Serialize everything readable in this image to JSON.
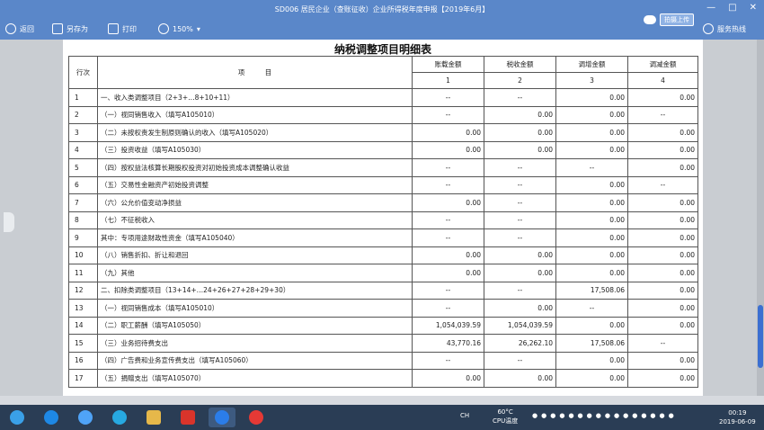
{
  "window": {
    "title": "SD006 居民企业（查账征收）企业所得税年度申报【2019年6月】",
    "minimize": "—",
    "maximize": "□",
    "close": "✕"
  },
  "toolbar": {
    "back": "返回",
    "save_as": "另存为",
    "print": "打印",
    "zoom": "150%",
    "upload": "拍摄上传",
    "hotline": "服务热线"
  },
  "doc": {
    "title": "纳税调整项目明细表",
    "headers": {
      "seq": "行次",
      "item": "项　　　目",
      "book": "账载金额",
      "tax": "税收金额",
      "inc": "调增金额",
      "dec": "调减金额",
      "n1": "1",
      "n2": "2",
      "n3": "3",
      "n4": "4"
    },
    "rows": [
      {
        "seq": "1",
        "item": "一、收入类调整项目（2+3+…8+10+11）",
        "c1": "--",
        "c2": "--",
        "c3": "0.00",
        "c4": "0.00"
      },
      {
        "seq": "2",
        "item": "（一）视同销售收入（填写A105010）",
        "c1": "--",
        "c2": "0.00",
        "c3": "0.00",
        "c4": "--"
      },
      {
        "seq": "3",
        "item": "（二）未按权责发生制原则确认的收入（填写A105020）",
        "c1": "0.00",
        "c2": "0.00",
        "c3": "0.00",
        "c4": "0.00"
      },
      {
        "seq": "4",
        "item": "（三）投资收益（填写A105030）",
        "c1": "0.00",
        "c2": "0.00",
        "c3": "0.00",
        "c4": "0.00"
      },
      {
        "seq": "5",
        "item": "（四）按权益法核算长期股权投资对初始投资成本调整确认收益",
        "c1": "--",
        "c2": "--",
        "c3": "--",
        "c4": "0.00"
      },
      {
        "seq": "6",
        "item": "（五）交易性金融资产初始投资调整",
        "c1": "--",
        "c2": "--",
        "c3": "0.00",
        "c4": "--"
      },
      {
        "seq": "7",
        "item": "（六）公允价值变动净损益",
        "c1": "0.00",
        "c2": "--",
        "c3": "0.00",
        "c4": "0.00"
      },
      {
        "seq": "8",
        "item": "（七）不征税收入",
        "c1": "--",
        "c2": "--",
        "c3": "0.00",
        "c4": "0.00"
      },
      {
        "seq": "9",
        "item": "其中：专项用途财政性资金（填写A105040）",
        "c1": "--",
        "c2": "--",
        "c3": "0.00",
        "c4": "0.00"
      },
      {
        "seq": "10",
        "item": "（八）销售折扣、折让和退回",
        "c1": "0.00",
        "c2": "0.00",
        "c3": "0.00",
        "c4": "0.00"
      },
      {
        "seq": "11",
        "item": "（九）其他",
        "c1": "0.00",
        "c2": "0.00",
        "c3": "0.00",
        "c4": "0.00"
      },
      {
        "seq": "12",
        "item": "二、扣除类调整项目（13+14+…24+26+27+28+29+30）",
        "c1": "--",
        "c2": "--",
        "c3": "17,508.06",
        "c4": "0.00"
      },
      {
        "seq": "13",
        "item": "（一）视同销售成本（填写A105010）",
        "c1": "--",
        "c2": "0.00",
        "c3": "--",
        "c4": "0.00"
      },
      {
        "seq": "14",
        "item": "（二）职工薪酬（填写A105050）",
        "c1": "1,054,039.59",
        "c2": "1,054,039.59",
        "c3": "0.00",
        "c4": "0.00"
      },
      {
        "seq": "15",
        "item": "（三）业务招待费支出",
        "c1": "43,770.16",
        "c2": "26,262.10",
        "c3": "17,508.06",
        "c4": "--"
      },
      {
        "seq": "16",
        "item": "（四）广告费和业务宣传费支出（填写A105060）",
        "c1": "--",
        "c2": "--",
        "c3": "0.00",
        "c4": "0.00"
      },
      {
        "seq": "17",
        "item": "（五）捐赠支出（填写A105070）",
        "c1": "0.00",
        "c2": "0.00",
        "c3": "0.00",
        "c4": "0.00"
      }
    ]
  },
  "taskbar": {
    "ime": "CH",
    "temp": "60°C",
    "temp_label": "CPU温度",
    "time": "00:19",
    "date": "2019-06-09"
  },
  "colors": {
    "titlebar": "#5a87c9",
    "taskbar": "#2a3d55",
    "scroll_thumb": "#3b6fd1"
  }
}
